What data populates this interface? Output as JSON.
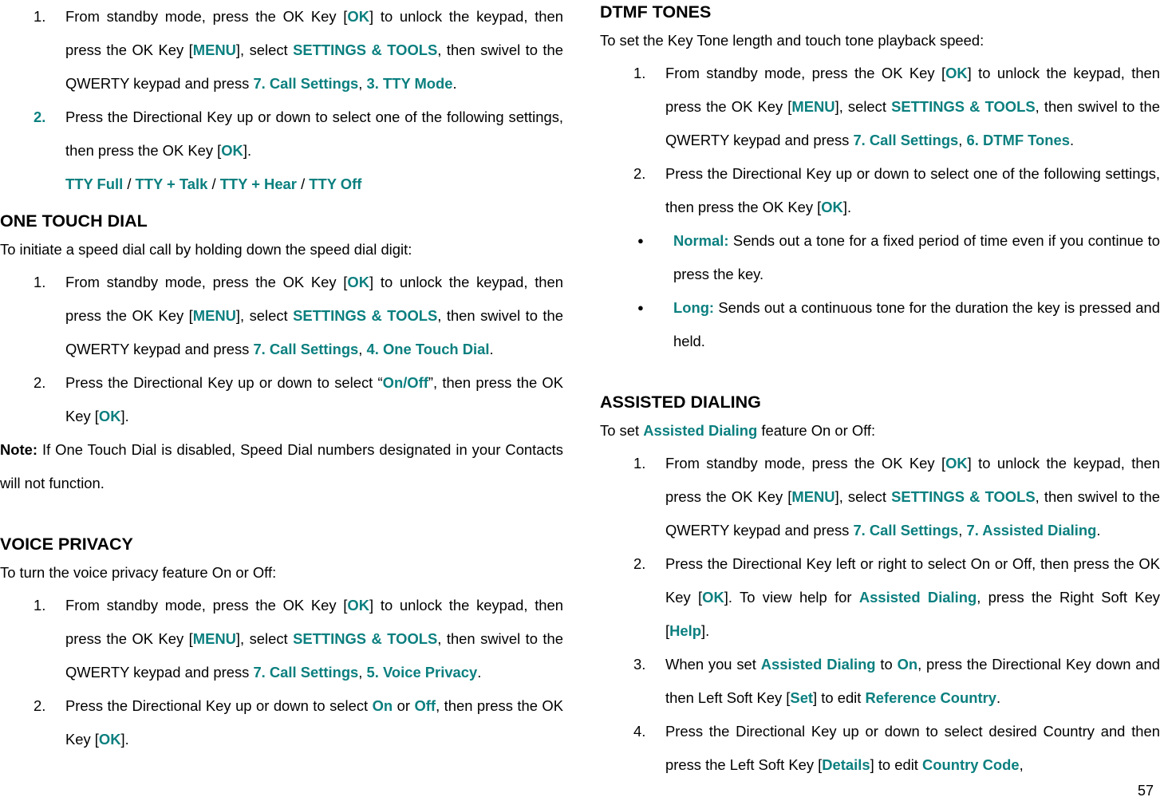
{
  "document": {
    "page_number": "57",
    "accent_color": "#0b7f7f",
    "text_color": "#000000",
    "background_color": "#ffffff"
  },
  "left_column": {
    "continued_list": {
      "item1": {
        "number": "1.",
        "t1": "From standby mode, press the OK Key [",
        "k1": "OK",
        "t2": "] to unlock the keypad, then press the OK Key [",
        "k2": "MENU",
        "t3": "], select ",
        "k3": "SETTINGS & TOOLS",
        "t4": ", then swivel to the QWERTY keypad and press ",
        "k4": "7. Call Settings",
        "t5": ", ",
        "k5": "3. TTY Mode",
        "t6": "."
      },
      "item2": {
        "number": "2.",
        "t1": "Press the Directional Key up or down to select one of the following settings, then press the OK Key [",
        "k1": "OK",
        "t2": "]."
      },
      "options": {
        "o1": "TTY Full",
        "sep1": " / ",
        "o2": "TTY + Talk",
        "sep2": " / ",
        "o3": "TTY + Hear",
        "sep3": " / ",
        "o4": "TTY Off"
      }
    },
    "one_touch_dial": {
      "title": "ONE TOUCH DIAL",
      "lead": "To initiate a speed dial call by holding down the speed dial digit:",
      "item1": {
        "t1": "From standby mode, press the OK Key [",
        "k1": "OK",
        "t2": "] to unlock the keypad, then press the OK Key [",
        "k2": "MENU",
        "t3": "], select ",
        "k3": "SETTINGS & TOOLS",
        "t4": ", then swivel to the QWERTY keypad and press ",
        "k4": "7. Call Settings",
        "t5": ", ",
        "k5": "4. One Touch Dial",
        "t6": "."
      },
      "item2": {
        "t1": "Press the Directional Key up or down to select “",
        "k1": "On/Off",
        "t2": "”, then press the OK Key [",
        "k2": "OK",
        "t3": "]."
      },
      "note": {
        "label": "Note:",
        "text": " If One Touch Dial is disabled, Speed Dial numbers designated in your Contacts will not function."
      }
    },
    "voice_privacy": {
      "title": "VOICE PRIVACY",
      "lead": "To turn the voice privacy feature On or Off:",
      "item1": {
        "t1": "From standby mode, press the OK Key [",
        "k1": "OK",
        "t2": "] to unlock the keypad, then press the OK Key [",
        "k2": "MENU",
        "t3": "], select ",
        "k3": "SETTINGS & TOOLS",
        "t4": ", then swivel to the QWERTY keypad and press ",
        "k4": "7. Call Settings",
        "t5": ", ",
        "k5": "5. Voice Privacy",
        "t6": "."
      },
      "item2": {
        "t1": "Press the Directional Key up or down to select ",
        "k1": "On",
        "t2": " or ",
        "k2": "Off",
        "t3": ", then press the OK Key [",
        "k3": "OK",
        "t4": "]."
      }
    }
  },
  "right_column": {
    "dtmf_tones": {
      "title": "DTMF TONES",
      "lead": "To set the Key Tone length and touch tone playback speed:",
      "item1": {
        "t1": "From standby mode, press the OK Key [",
        "k1": "OK",
        "t2": "] to unlock the keypad, then press the OK Key [",
        "k2": "MENU",
        "t3": "], select ",
        "k3": "SETTINGS & TOOLS",
        "t4": ", then swivel to the QWERTY keypad and press ",
        "k4": "7. Call Settings",
        "t5": ", ",
        "k5": "6. DTMF Tones",
        "t6": "."
      },
      "item2": {
        "t1": "Press the Directional Key up or down to select one of the following settings, then press the OK Key [",
        "k1": "OK",
        "t2": "]."
      },
      "bullets": [
        {
          "label": "Normal:",
          "text": "  Sends out a tone for a fixed period of time even if you continue to press the key."
        },
        {
          "label": "Long:",
          "text": "  Sends out a continuous tone for the duration the key is pressed and held."
        }
      ]
    },
    "assisted_dialing": {
      "title": "ASSISTED DIALING",
      "lead_t1": "To set ",
      "lead_k1": "Assisted Dialing",
      "lead_t2": " feature On or Off:",
      "item1": {
        "t1": "From standby mode, press the OK Key [",
        "k1": "OK",
        "t2": "] to unlock the keypad, then press the OK Key [",
        "k2": "MENU",
        "t3": "], select ",
        "k3": "SETTINGS & TOOLS",
        "t4": ", then swivel to the QWERTY keypad and press ",
        "k4": "7. Call Settings",
        "t5": ", ",
        "k5": "7. Assisted Dialing",
        "t6": "."
      },
      "item2": {
        "t1": "Press the Directional Key left or right to select On or Off, then press the OK Key [",
        "k1": "OK",
        "t2": "]. To view help for ",
        "k2": "Assisted Dialing",
        "t3": ", press the Right Soft Key [",
        "k3": "Help",
        "t4": "]."
      },
      "item3": {
        "t1": "When you set ",
        "k1": "Assisted Dialing",
        "t2": " to ",
        "k2": "On",
        "t3": ", press the Directional Key down and then Left Soft Key [",
        "k3": "Set",
        "t4": "] to edit ",
        "k4": "Reference Country",
        "t5": "."
      },
      "item4": {
        "t1": "Press the Directional Key up or down to select desired Country and then press the Left Soft Key [",
        "k1": "Details",
        "t2": "] to edit ",
        "k2": "Country Code",
        "t3": ","
      }
    }
  }
}
